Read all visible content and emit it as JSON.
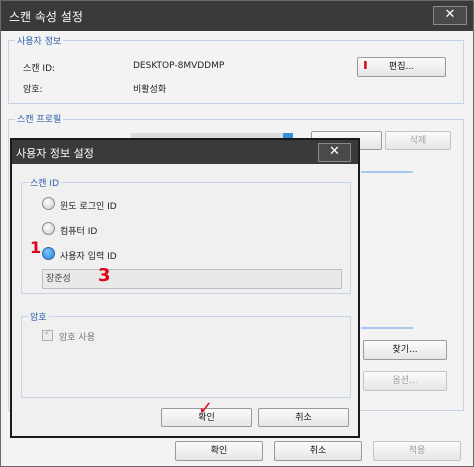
{
  "main_window": {
    "title": "스캔 속성 설정",
    "close_glyph": "✕",
    "user_info": {
      "group_title": "사용자 정보",
      "scan_id_label": "스캔 ID:",
      "scan_id_value": "DESKTOP-8MVDDMP",
      "password_label": "암호:",
      "password_value": "비활성화",
      "edit_button": "편집..."
    },
    "scan_profile": {
      "group_title": "스캔 프로필",
      "delete_button": "삭제",
      "find_button": "찾기...",
      "options_button": "옵션..."
    },
    "footer": {
      "ok": "확인",
      "cancel": "취소",
      "apply": "적용"
    }
  },
  "dialog": {
    "title": "사용자 정보 설정",
    "close_glyph": "✕",
    "scan_id_group": "스캔 ID",
    "radios": [
      {
        "label": "윈도 로그인 ID",
        "checked": false
      },
      {
        "label": "컴퓨터 ID",
        "checked": false
      },
      {
        "label": "사용자 입력 ID",
        "checked": true
      }
    ],
    "user_input_value": "장준성",
    "password_group": "암호",
    "use_password_label": "암호 사용",
    "ok_button": "확인",
    "cancel_button": "취소"
  },
  "annotations": {
    "mark_1": "ı",
    "mark_2": "1",
    "mark_3": "3",
    "mark_check": "✓"
  },
  "colors": {
    "titlebar": "#3a3a3a",
    "group_title_blue": "#2b5fa8",
    "annotation_red": "#e0001b"
  }
}
